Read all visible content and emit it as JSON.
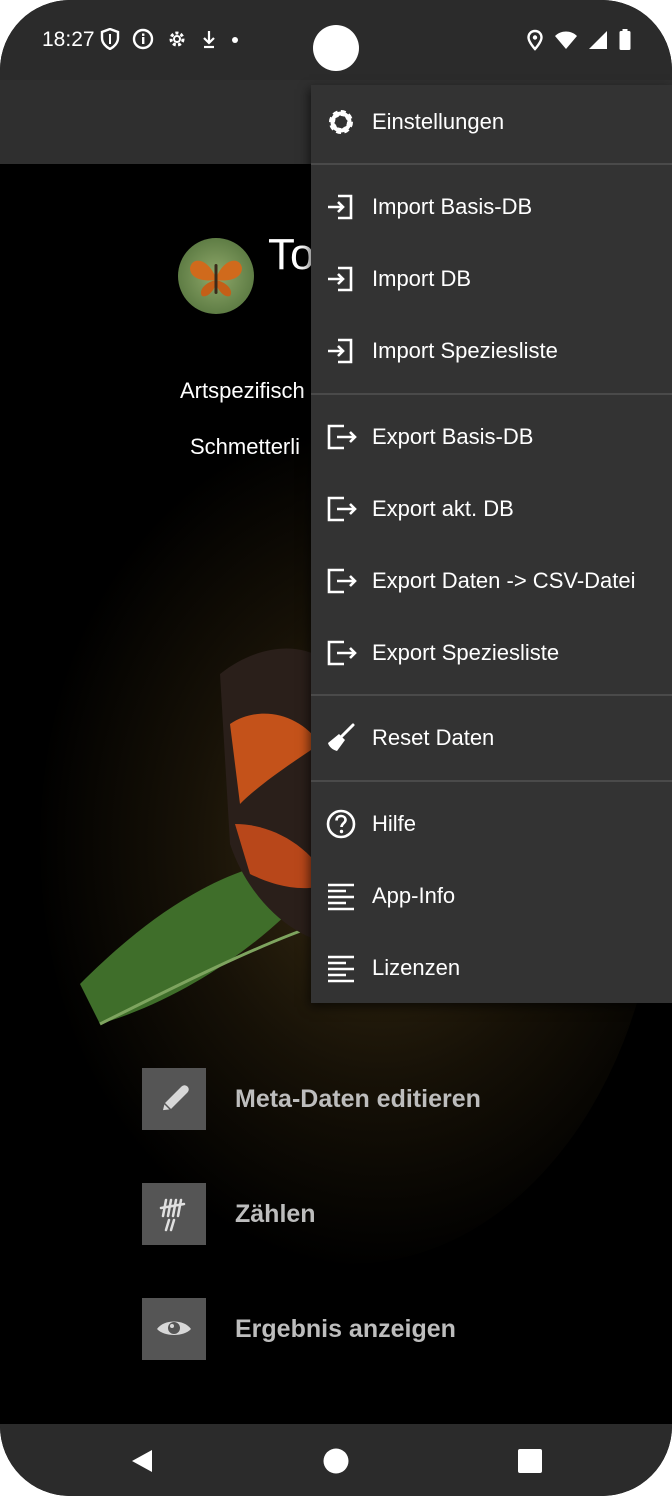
{
  "status_bar": {
    "time": "18:27"
  },
  "app": {
    "title": "To",
    "subtitle_1": "Artspezifisch",
    "subtitle_2": "Schmetterli"
  },
  "actions": [
    {
      "label": "Meta-Daten editieren",
      "icon": "pencil-icon"
    },
    {
      "label": "Zählen",
      "icon": "tally-icon"
    },
    {
      "label": "Ergebnis anzeigen",
      "icon": "eye-icon"
    }
  ],
  "menu": {
    "items": [
      {
        "label": "Einstellungen",
        "icon": "gear-icon"
      },
      {
        "label": "Import Basis-DB",
        "icon": "import-icon"
      },
      {
        "label": "Import DB",
        "icon": "import-icon"
      },
      {
        "label": "Import Speziesliste",
        "icon": "import-icon"
      },
      {
        "label": "Export Basis-DB",
        "icon": "export-icon"
      },
      {
        "label": "Export akt. DB",
        "icon": "export-icon"
      },
      {
        "label": "Export Daten -> CSV-Datei",
        "icon": "export-icon"
      },
      {
        "label": "Export Speziesliste",
        "icon": "export-icon"
      },
      {
        "label": "Reset Daten",
        "icon": "broom-icon"
      },
      {
        "label": "Hilfe",
        "icon": "help-icon"
      },
      {
        "label": "App-Info",
        "icon": "text-lines-icon"
      },
      {
        "label": "Lizenzen",
        "icon": "text-lines-icon"
      }
    ]
  },
  "colors": {
    "menu_bg": "#333333",
    "appbar_bg": "#2f2f2f",
    "status_bg": "#2b2b2b",
    "button_icon_bg": "#555555",
    "button_text": "#bdbdbd"
  }
}
